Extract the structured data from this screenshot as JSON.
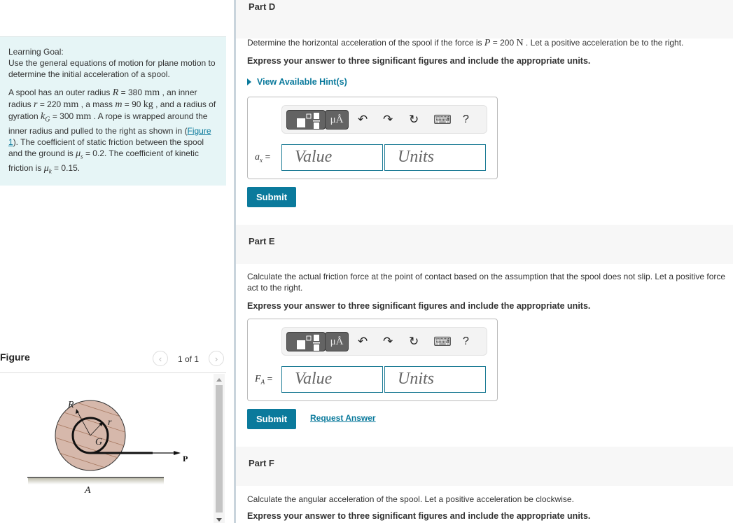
{
  "left": {
    "learning_goal": {
      "title": "Learning Goal:",
      "text": "Use the general equations of motion for plane motion to determine the initial acceleration of a spool."
    },
    "problem": {
      "intro": "A spool has an outer radius ",
      "R_sym": "R",
      "R_val": " = 380 ",
      "R_unit": "mm",
      "s2": " , an inner radius ",
      "r_sym": "r",
      "r_val": " = 220 ",
      "r_unit": "mm",
      "s3": " , a mass ",
      "m_sym": "m",
      "m_val": " = 90 ",
      "m_unit": "kg",
      "s4": " , and a radius of gyration ",
      "k_sym": "k",
      "k_sub": "G",
      "k_val": " = 300 ",
      "k_unit": "mm",
      "s5": " . A rope is wrapped around the inner radius and pulled to the right as shown in (",
      "figure_link": "Figure 1",
      "s6": "). The coefficient of static friction between the spool and the ground is ",
      "mus_sym": "μ",
      "mus_sub": "s",
      "mus_val": " = 0.2. The coefficient of kinetic friction is ",
      "muk_sym": "μ",
      "muk_sub": "k",
      "muk_val": " = 0.15."
    },
    "figure": {
      "title": "Figure",
      "pager": "1 of 1",
      "prev_icon": "‹",
      "next_icon": "›",
      "labels": {
        "R": "R",
        "r": "r",
        "G": "G",
        "P": "P",
        "A": "A"
      }
    }
  },
  "parts": [
    {
      "title": "Part D",
      "question_pre": "Determine the horizontal acceleration of the spool if the force is ",
      "q_sym": "P",
      "q_val": " = 200 ",
      "q_unit": "N",
      "question_post": " . Let a positive acceleration be to the right.",
      "express": "Express your answer to three significant figures and include the appropriate units.",
      "hint": "View Available Hint(s)",
      "var_sym": "a",
      "var_sub": "x",
      "var_eq": " =",
      "value_placeholder": "Value",
      "units_placeholder": "Units",
      "submit": "Submit"
    },
    {
      "title": "Part E",
      "question": "Calculate the actual friction force at the point of contact based on the assumption that the spool does not slip. Let a positive force act to the right.",
      "express": "Express your answer to three significant figures and include the appropriate units.",
      "var_sym": "F",
      "var_sub": "A",
      "var_eq": " =",
      "value_placeholder": "Value",
      "units_placeholder": "Units",
      "submit": "Submit",
      "request_answer": "Request Answer"
    },
    {
      "title": "Part F",
      "question": "Calculate the angular acceleration of the spool. Let a positive acceleration be clockwise.",
      "express": "Express your answer to three significant figures and include the appropriate units."
    }
  ],
  "toolbar": {
    "units_label": "μÅ",
    "undo_icon": "↶",
    "redo_icon": "↷",
    "reset_icon": "↻",
    "keyboard_icon": "⌨",
    "help_label": "?"
  },
  "colors": {
    "accent": "#0b7a9c",
    "goal_bg": "#e6f5f6",
    "part_header_bg": "#f7f7f7"
  }
}
